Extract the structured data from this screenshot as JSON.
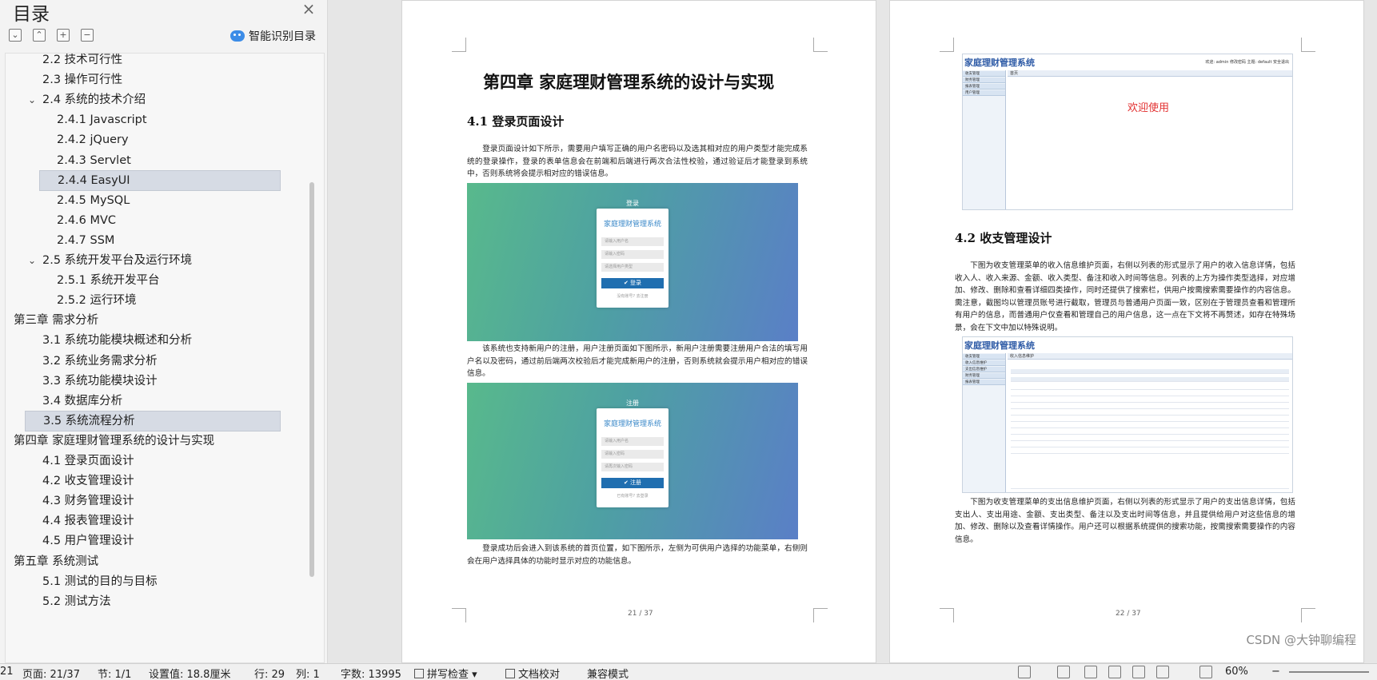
{
  "sidebar": {
    "title": "目录",
    "close_icon": "×",
    "toolbar": [
      {
        "name": "collapse-all-button",
        "glyph": "⌄"
      },
      {
        "name": "expand-all-button",
        "glyph": "⌃"
      },
      {
        "name": "add-heading-button",
        "glyph": "+"
      },
      {
        "name": "remove-heading-button",
        "glyph": "−"
      }
    ],
    "smart_toc_label": "智能识别目录",
    "items": [
      {
        "label": "2.2  技术可行性",
        "level": 2,
        "chevron": ""
      },
      {
        "label": "2.3  操作可行性",
        "level": 2,
        "chevron": ""
      },
      {
        "label": "2.4  系统的技术介绍",
        "level": 2,
        "chevron": "v"
      },
      {
        "label": "2.4.1 Javascript",
        "level": 3,
        "chevron": ""
      },
      {
        "label": "2.4.2 jQuery",
        "level": 3,
        "chevron": ""
      },
      {
        "label": "2.4.3 Servlet",
        "level": 3,
        "chevron": ""
      },
      {
        "label": "2.4.4 EasyUI",
        "level": 3,
        "chevron": "",
        "selected": true
      },
      {
        "label": "2.4.5 MySQL",
        "level": 3,
        "chevron": ""
      },
      {
        "label": "2.4.6 MVC",
        "level": 3,
        "chevron": ""
      },
      {
        "label": "2.4.7 SSM",
        "level": 3,
        "chevron": ""
      },
      {
        "label": "2.5  系统开发平台及运行环境",
        "level": 2,
        "chevron": "v"
      },
      {
        "label": "2.5.1  系统开发平台",
        "level": 3,
        "chevron": ""
      },
      {
        "label": "2.5.2  运行环境",
        "level": 3,
        "chevron": ""
      },
      {
        "label": "第三章  需求分析",
        "level": 1,
        "chevron": "v"
      },
      {
        "label": "3.1  系统功能模块概述和分析",
        "level": 2,
        "chevron": ""
      },
      {
        "label": "3.2  系统业务需求分析",
        "level": 2,
        "chevron": ""
      },
      {
        "label": "3.3  系统功能模块设计",
        "level": 2,
        "chevron": ""
      },
      {
        "label": "3.4  数据库分析",
        "level": 2,
        "chevron": ""
      },
      {
        "label": "3.5 系统流程分析",
        "level": 2,
        "chevron": "",
        "selected": true
      },
      {
        "label": "第四章  家庭理财管理系统的设计与实现",
        "level": 1,
        "chevron": "v"
      },
      {
        "label": "4.1    登录页面设计",
        "level": 2,
        "chevron": ""
      },
      {
        "label": "4.2    收支管理设计",
        "level": 2,
        "chevron": ""
      },
      {
        "label": "4.3    财务管理设计",
        "level": 2,
        "chevron": ""
      },
      {
        "label": "4.4    报表管理设计",
        "level": 2,
        "chevron": ""
      },
      {
        "label": "4.5    用户管理设计",
        "level": 2,
        "chevron": ""
      },
      {
        "label": "第五章  系统测试",
        "level": 1,
        "chevron": "v"
      },
      {
        "label": "5.1  测试的目的与目标",
        "level": 2,
        "chevron": ""
      },
      {
        "label": "5.2  测试方法",
        "level": 2,
        "chevron": ""
      }
    ]
  },
  "page21": {
    "chapter_title": "第四章  家庭理财管理系统的设计与实现",
    "section_title": "4.1    登录页面设计",
    "para1": "登录页面设计如下所示，需要用户填写正确的用户名密码以及选其相对应的用户类型才能完成系统的登录操作，登录的表单信息会在前端和后端进行两次合法性校验，通过验证后才能登录到系统中，否则系统将会提示相对应的错误信息。",
    "login_shot": {
      "header": "登录",
      "title": "家庭理财管理系统",
      "fields": [
        "请输入用户名",
        "请输入密码",
        "请选择用户类型"
      ],
      "button": "✔ 登录",
      "link": "没有账号? 去注册"
    },
    "para2": "该系统也支持新用户的注册，用户注册页面如下图所示，新用户注册需要注册用户合法的填写用户名以及密码，通过前后端两次校验后才能完成新用户的注册，否则系统就会提示用户相对应的错误信息。",
    "register_shot": {
      "header": "注册",
      "title": "家庭理财管理系统",
      "fields": [
        "请输入用户名",
        "请输入密码",
        "请再次输入密码"
      ],
      "button": "✔ 注册",
      "link": "已有账号? 去登录"
    },
    "para3": "登录成功后会进入到该系统的首页位置，如下图所示，左侧为可供用户选择的功能菜单，右侧则会在用户选择具体的功能时显示对应的功能信息。",
    "page_num": "21 / 37"
  },
  "page22": {
    "app_title": "家庭理财管理系统",
    "app_toolbar": "欢迎: admin    修改密码    主题: default    安全退出",
    "home_tab": "首页",
    "side_items": [
      "收支管理",
      "财务管理",
      "报表管理",
      "用户管理"
    ],
    "welcome": "欢迎使用",
    "section_title": "4.2    收支管理设计",
    "para1": "下图为收支管理菜单的收入信息维护页面，右侧以列表的形式显示了用户的收入信息详情，包括收入人、收入来源、金额、收入类型、备注和收入时间等信息。列表的上方为操作类型选择，对应增加、修改、删除和查看详细四类操作，同时还提供了搜索栏，供用户按需搜索需要操作的内容信息。需注意，截图均以管理员账号进行截取，管理员与普通用户页面一致，区别在于管理员查看和管理所有用户的信息，而普通用户仅查看和管理自己的用户信息，这一点在下文将不再赘述，如存在特殊场景，会在下文中加以特殊说明。",
    "income_tab": "收入信息维护",
    "income_side": [
      "收支管理",
      "收入信息维护",
      "支出信息维护",
      "财务管理",
      "报表管理"
    ],
    "para2": "下图为收支管理菜单的支出信息维护页面，右侧以列表的形式显示了用户的支出信息详情，包括支出人、支出用途、金额、支出类型、备注以及支出时间等信息，并且提供给用户对这些信息的增加、修改、删除以及查看详情操作。用户还可以根据系统提供的搜索功能，按需搜索需要操作的内容信息。",
    "page_num": "22 / 37"
  },
  "watermark": "CSDN @大钟聊编程",
  "statusbar": {
    "line_prefix": "21",
    "page": "页面: 21/37",
    "section": "节: 1/1",
    "setting": "设置值: 18.8厘米",
    "row": "行: 29",
    "col": "列: 1",
    "words": "字数: 13995",
    "spell": "拼写检查",
    "proof": "文档校对",
    "compat": "兼容模式",
    "zoom": "60%"
  }
}
